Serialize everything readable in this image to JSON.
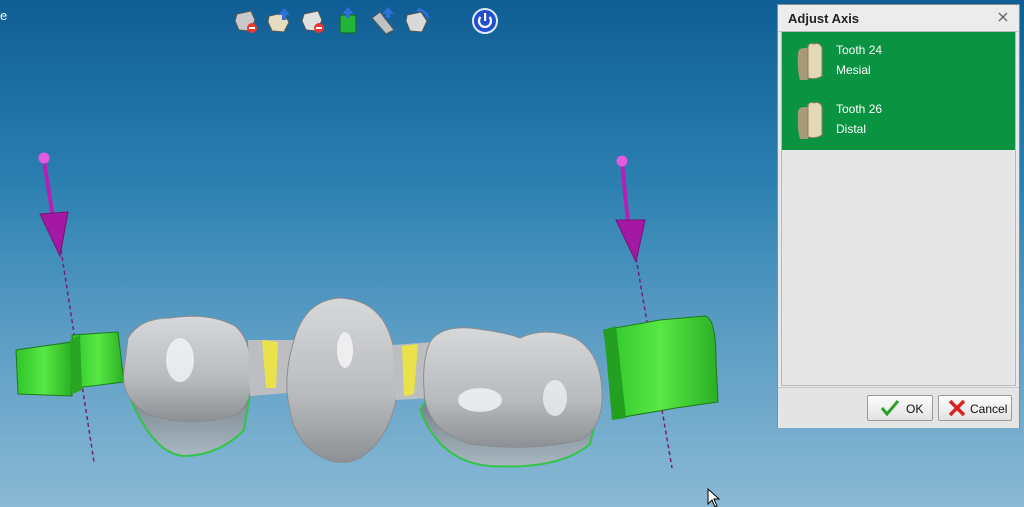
{
  "viewport": {
    "partial_label": "e",
    "toolbar": [
      {
        "name": "tool-remove-icon"
      },
      {
        "name": "tool-move-up-icon"
      },
      {
        "name": "tool-remove-2-icon"
      },
      {
        "name": "tool-green-up-icon"
      },
      {
        "name": "tool-axis-up-icon"
      },
      {
        "name": "tool-rotate-icon"
      },
      {
        "name": "power-icon"
      }
    ],
    "colors": {
      "axis_arrow": "#b51fb3",
      "abutment_green": "#34d62a",
      "connector_yellow": "#e9e24a",
      "tooth_gray": "#c9cbcd"
    }
  },
  "dialog": {
    "title": "Adjust Axis",
    "close_icon": "close-icon",
    "items": [
      {
        "name": "Tooth 24",
        "side": "Mesial",
        "icon": "tooth-icon"
      },
      {
        "name": "Tooth 26",
        "side": "Distal",
        "icon": "tooth-icon"
      }
    ],
    "selected_color": "#0a9441",
    "ok_label": "OK",
    "cancel_label": "Cancel",
    "ok_icon": "checkmark-icon",
    "cancel_icon": "cancel-x-icon"
  }
}
